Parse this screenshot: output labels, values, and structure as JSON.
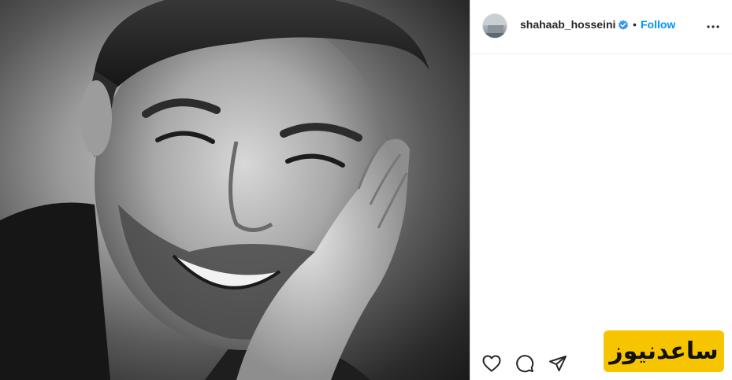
{
  "post": {
    "photo": {
      "description_icon": "portrait-photo"
    },
    "header": {
      "username": "shahaab_hosseini",
      "verified_icon": "verified-badge-icon",
      "separator": "•",
      "follow_label": "Follow",
      "more_icon": "more-options-icon"
    },
    "actions": {
      "like_icon": "heart-icon",
      "comment_icon": "comment-icon",
      "share_icon": "share-icon"
    },
    "watermark": {
      "text": "ساعدنیوز"
    },
    "colors": {
      "follow": "#0095f6",
      "verified": "#3897f0",
      "watermark_bg": "#f7c500"
    }
  }
}
